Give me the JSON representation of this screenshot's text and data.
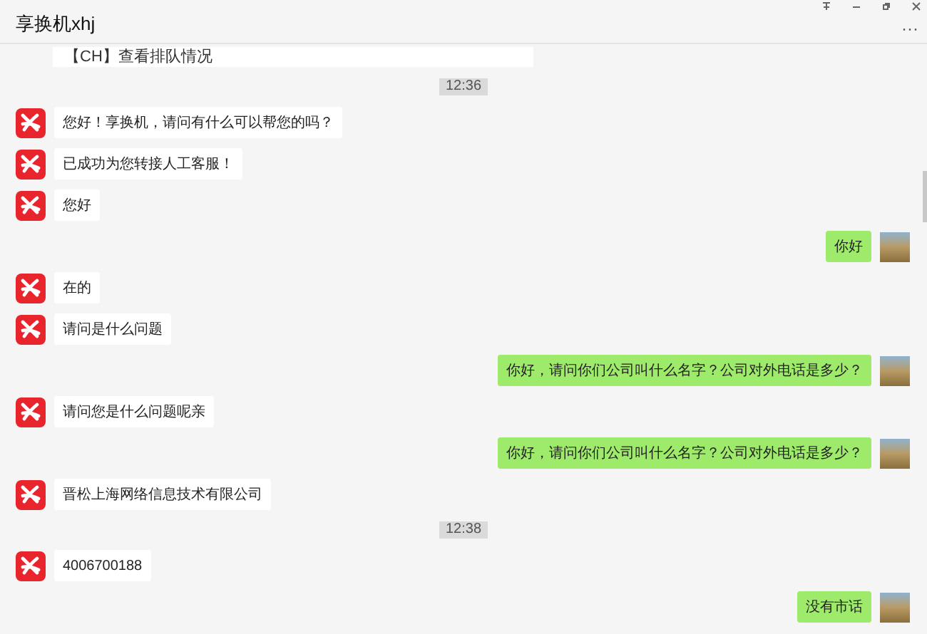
{
  "window": {
    "title": "享换机xhj",
    "more": "···"
  },
  "messages": [
    {
      "kind": "card",
      "text": "【CH】查看排队情况"
    },
    {
      "kind": "time",
      "text": "12:36"
    },
    {
      "kind": "incoming",
      "text": "您好！享换机，请问有什么可以帮您的吗？"
    },
    {
      "kind": "incoming",
      "text": "已成功为您转接人工客服！"
    },
    {
      "kind": "incoming",
      "text": "您好"
    },
    {
      "kind": "outgoing",
      "text": "你好"
    },
    {
      "kind": "incoming",
      "text": "在的"
    },
    {
      "kind": "incoming",
      "text": "请问是什么问题"
    },
    {
      "kind": "outgoing",
      "text": "你好，请问你们公司叫什么名字？公司对外电话是多少？"
    },
    {
      "kind": "incoming",
      "text": "请问您是什么问题呢亲"
    },
    {
      "kind": "outgoing",
      "text": "你好，请问你们公司叫什么名字？公司对外电话是多少？"
    },
    {
      "kind": "incoming",
      "text": "晋松上海网络信息技术有限公司"
    },
    {
      "kind": "time",
      "text": "12:38"
    },
    {
      "kind": "incoming",
      "text": "4006700188"
    },
    {
      "kind": "outgoing",
      "text": "没有市话"
    }
  ]
}
